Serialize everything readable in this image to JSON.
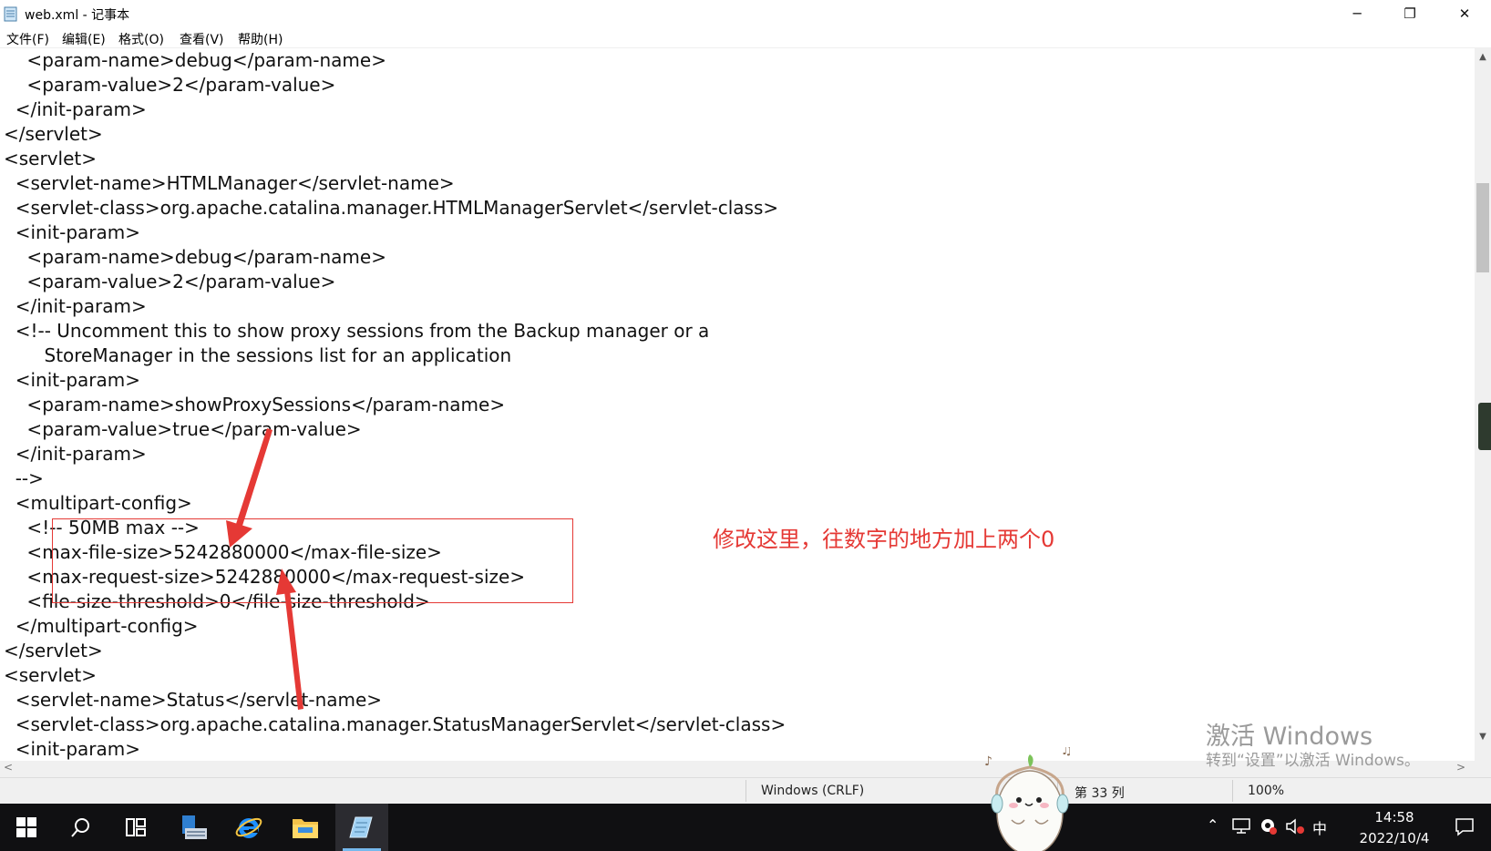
{
  "window": {
    "title": "web.xml - 记事本",
    "minimize": "─",
    "maximize": "❐",
    "close": "✕"
  },
  "menu": [
    "文件(F)",
    "编辑(E)",
    "格式(O)",
    "查看(V)",
    "帮助(H)"
  ],
  "editor": {
    "lines": [
      "    <param-name>debug</param-name>",
      "    <param-value>2</param-value>",
      "  </init-param>",
      "</servlet>",
      "<servlet>",
      "  <servlet-name>HTMLManager</servlet-name>",
      "  <servlet-class>org.apache.catalina.manager.HTMLManagerServlet</servlet-class>",
      "  <init-param>",
      "    <param-name>debug</param-name>",
      "    <param-value>2</param-value>",
      "  </init-param>",
      "  <!-- Uncomment this to show proxy sessions from the Backup manager or a",
      "       StoreManager in the sessions list for an application",
      "  <init-param>",
      "    <param-name>showProxySessions</param-name>",
      "    <param-value>true</param-value>",
      "  </init-param>",
      "  -->",
      "  <multipart-config>",
      "    <!-- 50MB max -->",
      "    <max-file-size>5242880000</max-file-size>",
      "    <max-request-size>5242880000</max-request-size>",
      "    <file-size-threshold>0</file-size-threshold>",
      "  </multipart-config>",
      "</servlet>",
      "<servlet>",
      "  <servlet-name>Status</servlet-name>",
      "  <servlet-class>org.apache.catalina.manager.StatusManagerServlet</servlet-class>",
      "  <init-param>"
    ]
  },
  "annotation": {
    "note": "修改这里，往数字的地方加上两个0",
    "color": "#e53935"
  },
  "status": {
    "encoding": "Windows (CRLF)",
    "position": "第 33 列",
    "zoom": "100%"
  },
  "watermark": {
    "line1": "激活 Windows",
    "line2": "转到“设置”以激活 Windows。"
  },
  "taskbar": {
    "items": [
      "windows-start-icon",
      "search-icon",
      "task-view-icon",
      "server-manager-icon",
      "internet-explorer-icon",
      "file-explorer-icon",
      "notepad-icon"
    ],
    "ime": "中",
    "time": "14:58",
    "date": "2022/10/4"
  }
}
